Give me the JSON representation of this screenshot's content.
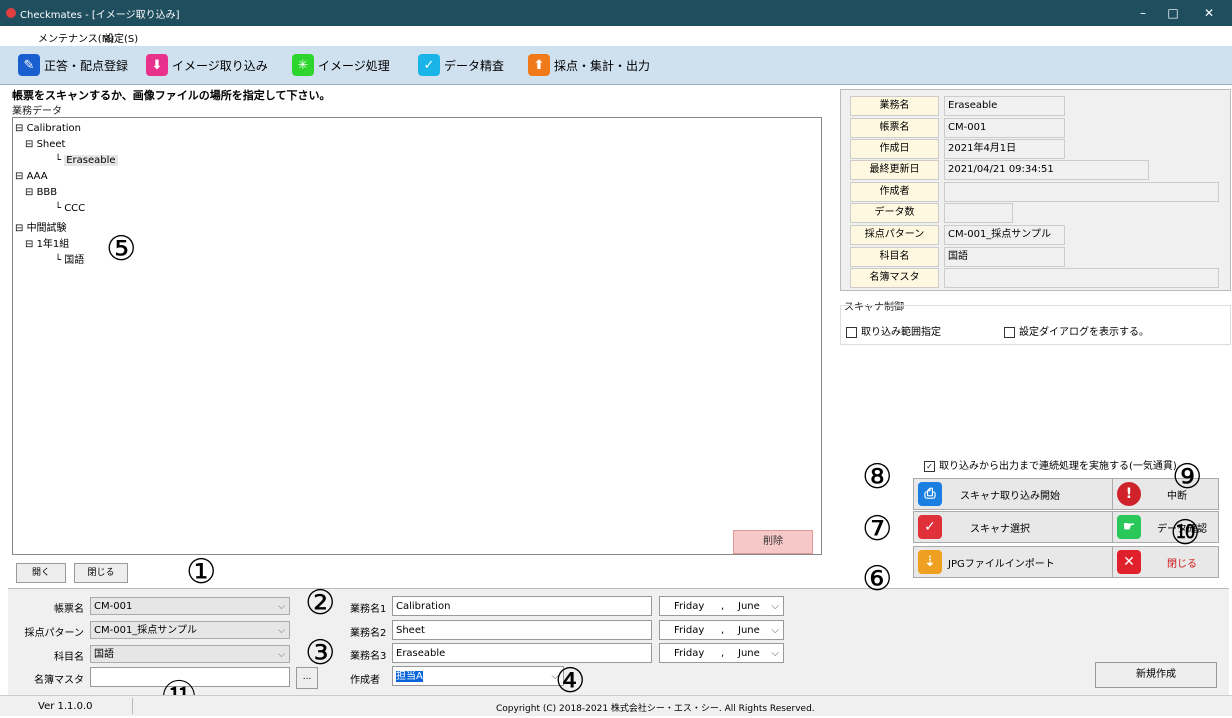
{
  "window": {
    "title": "Checkmates - [イメージ取り込み]",
    "controls": [
      "–",
      "□",
      "✕"
    ]
  },
  "menu": [
    "メンテナンス(M)",
    "設定(S)"
  ],
  "toolbar": [
    {
      "label": "正答・配点登録",
      "icon": "edit-icon",
      "color": "#1a5fd0"
    },
    {
      "label": "イメージ取り込み",
      "icon": "download-icon",
      "color": "#e8318a"
    },
    {
      "label": "イメージ処理",
      "icon": "sparkle-icon",
      "color": "#2fd52f"
    },
    {
      "label": "データ精査",
      "icon": "check-icon",
      "color": "#1ab5e8"
    },
    {
      "label": "採点・集計・出力",
      "icon": "upload-icon",
      "color": "#f07a1a"
    }
  ],
  "instruction": "帳票をスキャンするか、画像ファイルの場所を指定して下さい。",
  "tree_title": "業務データ",
  "tree": [
    {
      "text": "Calibration",
      "level": 0
    },
    {
      "text": "Sheet",
      "level": 1
    },
    {
      "text": "Eraseable",
      "level": 2,
      "selected": true
    },
    {
      "text": "AAA",
      "level": 0
    },
    {
      "text": "BBB",
      "level": 1
    },
    {
      "text": "CCC",
      "level": 2
    },
    {
      "text": "中間試験",
      "level": 0
    },
    {
      "text": "1年1組",
      "level": 1
    },
    {
      "text": "国語",
      "level": 2
    }
  ],
  "buttons": {
    "delete": "削除",
    "open": "開く",
    "close_small": "閉じる",
    "new": "新規作成",
    "browse": "..."
  },
  "info": [
    {
      "label": "業務名",
      "value": "Eraseable"
    },
    {
      "label": "帳票名",
      "value": "CM-001"
    },
    {
      "label": "作成日",
      "value": "2021年4月1日"
    },
    {
      "label": "最終更新日",
      "value": "2021/04/21 09:34:51"
    },
    {
      "label": "作成者",
      "value": ""
    },
    {
      "label": "データ数",
      "value": ""
    },
    {
      "label": "採点パターン",
      "value": "CM-001_採点サンプル"
    },
    {
      "label": "科目名",
      "value": "国語"
    },
    {
      "label": "名簿マスタ",
      "value": ""
    }
  ],
  "scanner": {
    "title": "スキャナ制御",
    "range_checkbox": "取り込み範囲指定",
    "dialog_checkbox": "設定ダイアログを表示する。"
  },
  "continuous": {
    "label": "取り込みから出力まで連続処理を実施する(一気通貫)",
    "checked": true
  },
  "actions": [
    {
      "label": "スキャナ取り込み開始",
      "icon": "scanner-icon",
      "color": "#1a7fe0"
    },
    {
      "label": "中断",
      "icon": "stop-icon",
      "color": "#d0222a"
    },
    {
      "label": "スキャナ選択",
      "icon": "scanner-select-icon",
      "color": "#e0303a"
    },
    {
      "label": "データ確認",
      "icon": "hand-icon",
      "color": "#2ac85a"
    },
    {
      "label": "JPGファイルインポート",
      "icon": "import-icon",
      "color": "#f0a020"
    },
    {
      "label": "閉じる",
      "icon": "close-icon",
      "color": "#e0202a",
      "text_color": "#d01818"
    }
  ],
  "form": {
    "sheet_label": "帳票名",
    "sheet_value": "CM-001",
    "pattern_label": "採点パターン",
    "pattern_value": "CM-001_採点サンプル",
    "subject_label": "科目名",
    "subject_value": "国語",
    "roster_label": "名簿マスタ",
    "roster_value": "",
    "biz1_label": "業務名1",
    "biz1_value": "Calibration",
    "biz2_label": "業務名2",
    "biz2_value": "Sheet",
    "biz3_label": "業務名3",
    "biz3_value": "Eraseable",
    "author_label": "作成者",
    "author_value": "担当A",
    "date_day": "Friday",
    "date_sep": ",",
    "date_month": "June"
  },
  "annotations": [
    "①",
    "②",
    "③",
    "④",
    "⑤",
    "⑥",
    "⑦",
    "⑧",
    "⑨",
    "⑩",
    "⑪"
  ],
  "status": {
    "version": "Ver 1.1.0.0",
    "copyright": "Copyright (C) 2018-2021 株式会社シー・エス・シー. All Rights Reserved."
  }
}
